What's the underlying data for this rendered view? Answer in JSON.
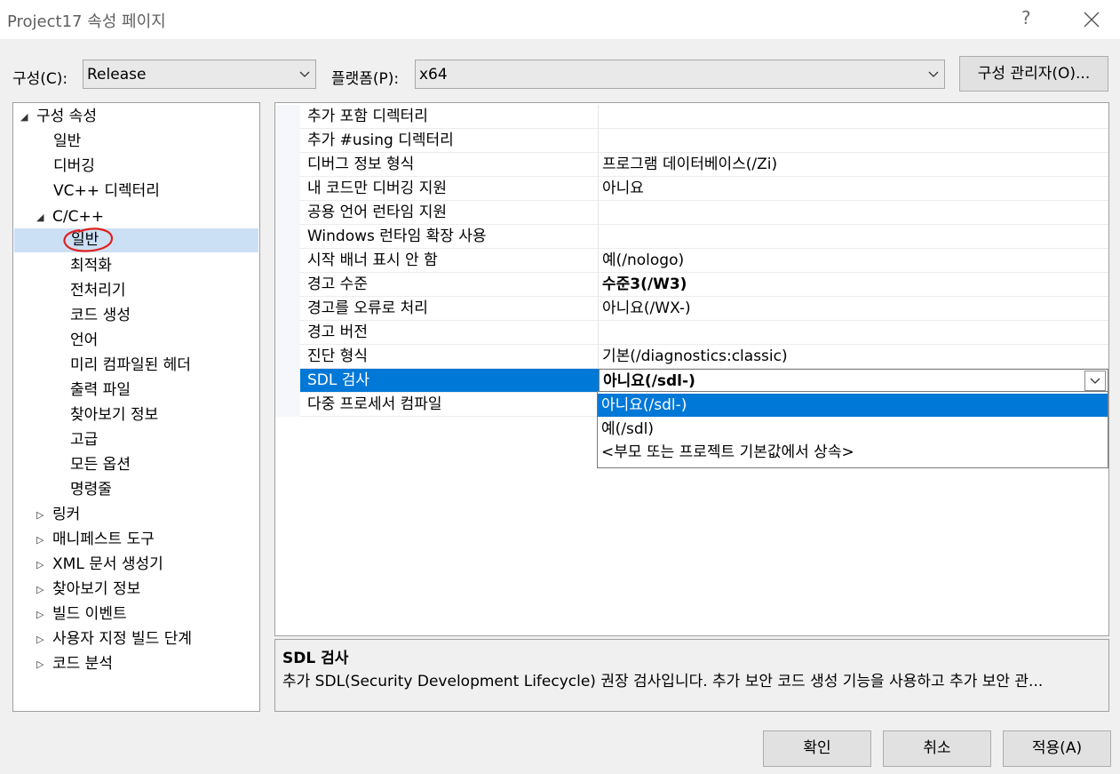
{
  "window": {
    "title": "Project17 속성 페이지",
    "help_label": "?"
  },
  "toolbar": {
    "config_label": "구성(C):",
    "config_value": "Release",
    "platform_label": "플랫폼(P):",
    "platform_value": "x64",
    "config_manager_label": "구성 관리자(O)..."
  },
  "tree": {
    "root": "구성 속성",
    "items": [
      {
        "label": "일반"
      },
      {
        "label": "디버깅"
      },
      {
        "label": "VC++ 디렉터리"
      },
      {
        "label": "C/C++"
      },
      {
        "label": "일반",
        "selected": true
      },
      {
        "label": "최적화"
      },
      {
        "label": "전처리기"
      },
      {
        "label": "코드 생성"
      },
      {
        "label": "언어"
      },
      {
        "label": "미리 컴파일된 헤더"
      },
      {
        "label": "출력 파일"
      },
      {
        "label": "찾아보기 정보"
      },
      {
        "label": "고급"
      },
      {
        "label": "모든 옵션"
      },
      {
        "label": "명령줄"
      },
      {
        "label": "링커"
      },
      {
        "label": "매니페스트 도구"
      },
      {
        "label": "XML 문서 생성기"
      },
      {
        "label": "찾아보기 정보"
      },
      {
        "label": "빌드 이벤트"
      },
      {
        "label": "사용자 지정 빌드 단계"
      },
      {
        "label": "코드 분석"
      }
    ]
  },
  "properties": [
    {
      "name": "추가 포함 디렉터리",
      "value": ""
    },
    {
      "name": "추가 #using 디렉터리",
      "value": ""
    },
    {
      "name": "디버그 정보 형식",
      "value": "프로그램 데이터베이스(/Zi)"
    },
    {
      "name": "내 코드만 디버깅 지원",
      "value": "아니요"
    },
    {
      "name": "공용 언어 런타임 지원",
      "value": ""
    },
    {
      "name": "Windows 런타임 확장 사용",
      "value": ""
    },
    {
      "name": "시작 배너 표시 안 함",
      "value": "예(/nologo)"
    },
    {
      "name": "경고 수준",
      "value": "수준3(/W3)",
      "bold": true
    },
    {
      "name": "경고를 오류로 처리",
      "value": "아니요(/WX-)"
    },
    {
      "name": "경고 버전",
      "value": ""
    },
    {
      "name": "진단 형식",
      "value": "기본(/diagnostics:classic)"
    },
    {
      "name": "SDL 검사",
      "value": "아니요(/sdl-)",
      "bold": true,
      "selected": true
    },
    {
      "name": "다중 프로세서 컴파일",
      "value": ""
    }
  ],
  "dropdown_options": [
    {
      "label": "아니요(/sdl-)",
      "highlighted": true
    },
    {
      "label": "예(/sdl)"
    },
    {
      "label": "<부모 또는 프로젝트 기본값에서 상속>"
    }
  ],
  "description": {
    "title": "SDL 검사",
    "text": "추가 SDL(Security Development Lifecycle) 권장 검사입니다. 추가 보안 코드 생성 기능을 사용하고 추가 보안 관..."
  },
  "buttons": {
    "ok": "확인",
    "cancel": "취소",
    "apply": "적용(A)"
  },
  "colors": {
    "selection": "#0078d7",
    "tree_selection": "#cce0f5",
    "annotation": "#e0201f"
  },
  "icons": [
    "close-icon",
    "chevron-down-icon",
    "expanded-arrow-icon",
    "collapsed-arrow-icon"
  ]
}
